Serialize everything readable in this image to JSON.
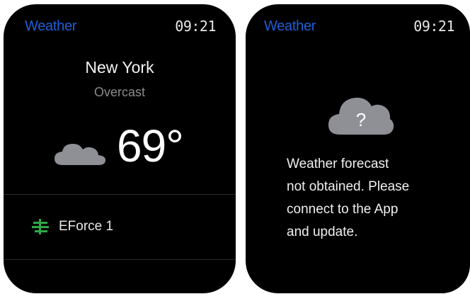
{
  "left_watch": {
    "app_title": "Weather",
    "time": "09:21",
    "city": "New York",
    "condition": "Overcast",
    "temperature": "69°",
    "weather_icon": "cloud-icon",
    "device": {
      "icon": "eforce-logo-icon",
      "name": "EForce 1"
    }
  },
  "right_watch": {
    "app_title": "Weather",
    "time": "09:21",
    "icon": "unknown-weather-icon",
    "icon_glyph": "?",
    "message_lines": [
      "Weather forecast",
      "not obtained. Please",
      "connect to the App",
      "and update."
    ]
  },
  "colors": {
    "title_blue": "#1e5fd6",
    "secondary_gray": "#8a8a8a",
    "cloud_gray": "#8e9096",
    "device_green": "#2ea84a"
  }
}
